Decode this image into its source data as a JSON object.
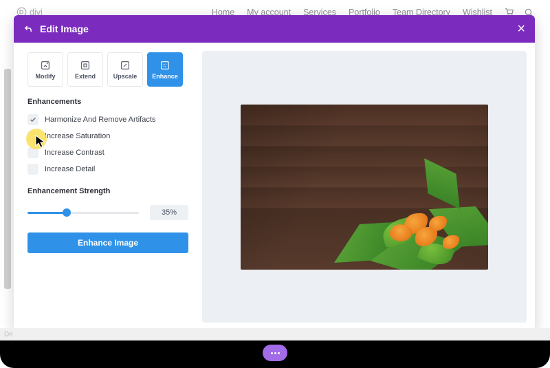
{
  "site": {
    "logo_text": "divi",
    "nav": [
      "Home",
      "My account",
      "Services",
      "Portfolio",
      "Team Directory",
      "Wishlist"
    ],
    "bottom_text": "De"
  },
  "modal": {
    "title": "Edit Image",
    "tabs": {
      "modify": "Modify",
      "extend": "Extend",
      "upscale": "Upscale",
      "enhance": "Enhance"
    },
    "section_heading": "Enhancements",
    "checks": [
      {
        "label": "Harmonize And Remove Artifacts",
        "checked": true
      },
      {
        "label": "Increase Saturation",
        "checked": false
      },
      {
        "label": "Increase Contrast",
        "checked": false
      },
      {
        "label": "Increase Detail",
        "checked": false
      }
    ],
    "strength_label": "Enhancement Strength",
    "strength_value": "35%",
    "strength_percent": 35,
    "button_label": "Enhance Image"
  }
}
